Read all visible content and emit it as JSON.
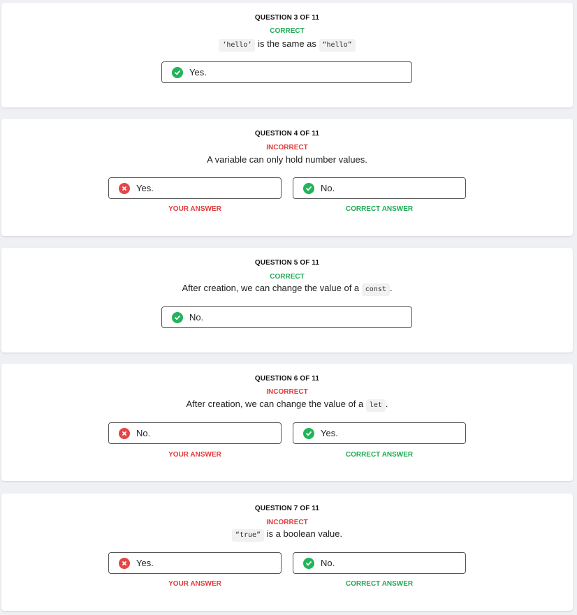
{
  "questions": [
    {
      "number_label": "QUESTION 3 OF 11",
      "status": "CORRECT",
      "prompt_code_1": "‘hello’",
      "prompt_mid": " is the same as ",
      "prompt_code_2": "“hello”",
      "answer": "Yes."
    },
    {
      "number_label": "QUESTION 4 OF 11",
      "status": "INCORRECT",
      "prompt": "A variable can only hold number values.",
      "your_answer": "Yes.",
      "correct_answer": "No."
    },
    {
      "number_label": "QUESTION 5 OF 11",
      "status": "CORRECT",
      "prompt_text": "After creation, we can change the value of a ",
      "prompt_code": "const",
      "prompt_end": ".",
      "answer": "No."
    },
    {
      "number_label": "QUESTION 6 OF 11",
      "status": "INCORRECT",
      "prompt_text": "After creation, we can change the value of a ",
      "prompt_code": "let",
      "prompt_end": ".",
      "your_answer": "No.",
      "correct_answer": "Yes."
    },
    {
      "number_label": "QUESTION 7 OF 11",
      "status": "INCORRECT",
      "prompt_code": "“true”",
      "prompt_text": " is a boolean value.",
      "your_answer": "Yes.",
      "correct_answer": "No."
    }
  ],
  "labels": {
    "your_answer": "YOUR ANSWER",
    "correct_answer": "CORRECT ANSWER"
  },
  "icons": {
    "correct": "check-circle-icon",
    "incorrect": "x-circle-icon"
  },
  "colors": {
    "correct": "#1faa55",
    "incorrect": "#e23b3b"
  }
}
